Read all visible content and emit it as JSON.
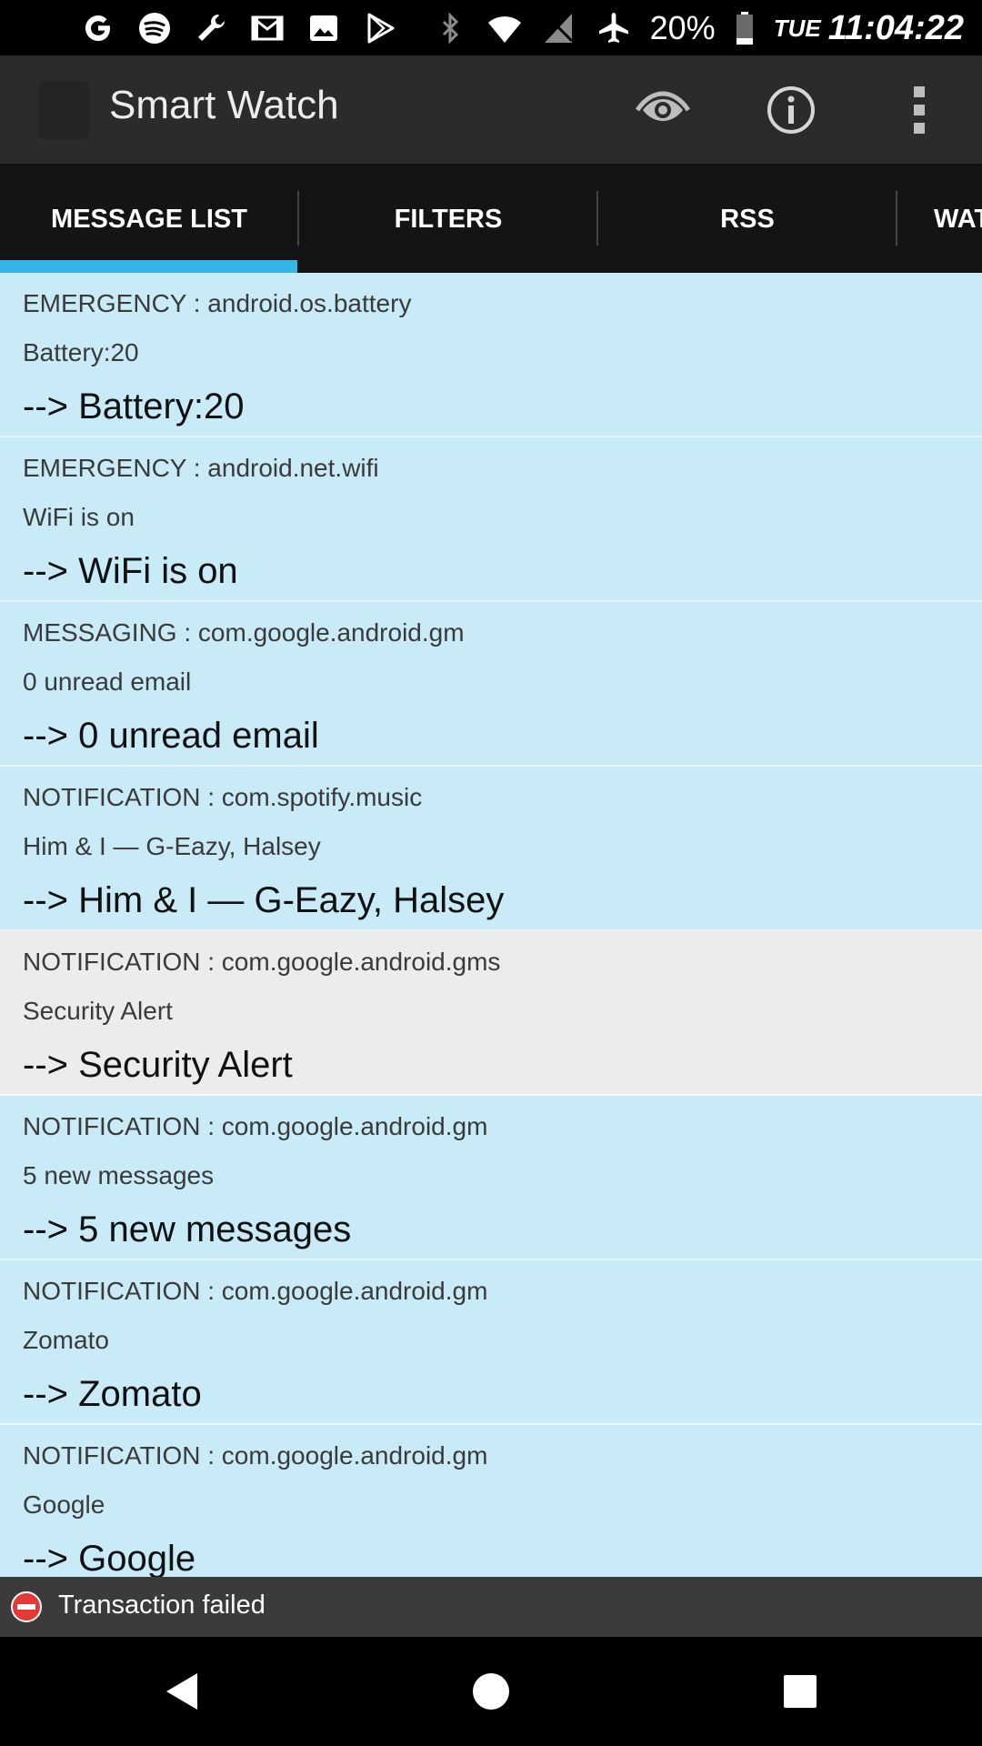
{
  "status_bar": {
    "left_icons": [
      "google-icon",
      "spotify-icon",
      "wrench-icon",
      "gmail-icon",
      "photos-icon",
      "play-store-icon"
    ],
    "right_icons": [
      "bluetooth-icon",
      "wifi-icon",
      "no-sim-icon",
      "airplane-icon"
    ],
    "battery_percent": "20%",
    "day": "TUE",
    "time": "11:04:22"
  },
  "app_bar": {
    "title": "Smart Watch",
    "actions": [
      "eye-icon",
      "info-icon",
      "overflow-menu-icon"
    ]
  },
  "tabs": [
    {
      "label": "MESSAGE LIST",
      "selected": true
    },
    {
      "label": "FILTERS",
      "selected": false
    },
    {
      "label": "RSS",
      "selected": false
    },
    {
      "label": "WAT",
      "selected": false
    }
  ],
  "messages": [
    {
      "source": "EMERGENCY : android.os.battery",
      "text": "Battery:20",
      "forward": "--> Battery:20",
      "highlighted": false
    },
    {
      "source": "EMERGENCY : android.net.wifi",
      "text": "WiFi is on",
      "forward": "--> WiFi is on",
      "highlighted": false
    },
    {
      "source": "MESSAGING : com.google.android.gm",
      "text": "0 unread email",
      "forward": "--> 0 unread email",
      "highlighted": false
    },
    {
      "source": "NOTIFICATION : com.spotify.music",
      "text": "Him & I — G-Eazy, Halsey",
      "forward": "--> Him & I — G-Eazy, Halsey",
      "highlighted": false
    },
    {
      "source": "NOTIFICATION : com.google.android.gms",
      "text": "Security Alert",
      "forward": "--> Security Alert",
      "highlighted": true
    },
    {
      "source": "NOTIFICATION : com.google.android.gm",
      "text": "5 new messages",
      "forward": "--> 5 new messages",
      "highlighted": false
    },
    {
      "source": "NOTIFICATION : com.google.android.gm",
      "text": "Zomato",
      "forward": "--> Zomato",
      "highlighted": false
    },
    {
      "source": "NOTIFICATION : com.google.android.gm",
      "text": "Google",
      "forward": "--> Google",
      "highlighted": false
    }
  ],
  "toast": {
    "icon": "error-icon",
    "text": "Transaction failed"
  },
  "nav_bar": [
    "back-icon",
    "home-icon",
    "recents-icon"
  ],
  "colors": {
    "accent": "#33b5e5",
    "row_background": "#c9ebf7",
    "row_highlight": "#ececec",
    "app_bar": "#2b2b2b",
    "tab_bar": "#141414"
  }
}
